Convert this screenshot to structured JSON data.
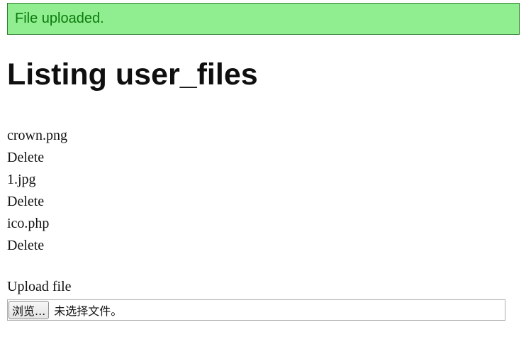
{
  "flash": {
    "message": "File uploaded.",
    "background_color": "#90ee90",
    "text_color": "#0b7a0b"
  },
  "page": {
    "title": "Listing user_files"
  },
  "files": [
    {
      "name": "crown.png",
      "delete_label": "Delete"
    },
    {
      "name": "1.jpg",
      "delete_label": "Delete"
    },
    {
      "name": "ico.php",
      "delete_label": "Delete"
    }
  ],
  "upload": {
    "label": "Upload file",
    "browse_label": "浏览...",
    "status": "未选择文件。"
  }
}
